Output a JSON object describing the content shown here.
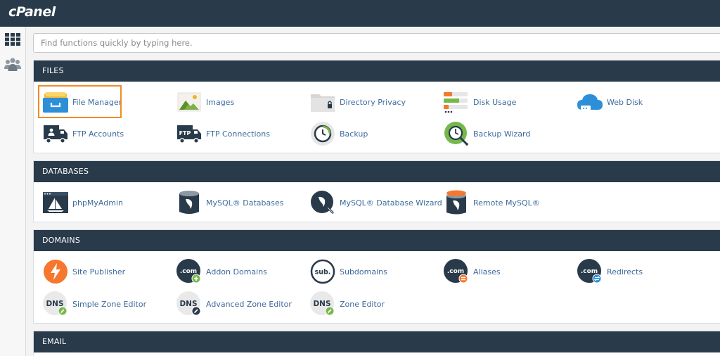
{
  "header": {
    "logo": "cPanel"
  },
  "search": {
    "placeholder": "Find functions quickly by typing here."
  },
  "sections": {
    "files": {
      "title": "FILES",
      "items": [
        {
          "label": "File Manager",
          "icon": "file-manager-icon"
        },
        {
          "label": "Images",
          "icon": "images-icon"
        },
        {
          "label": "Directory Privacy",
          "icon": "directory-privacy-icon"
        },
        {
          "label": "Disk Usage",
          "icon": "disk-usage-icon"
        },
        {
          "label": "Web Disk",
          "icon": "web-disk-icon"
        },
        {
          "label": "FTP Accounts",
          "icon": "ftp-accounts-icon"
        },
        {
          "label": "FTP Connections",
          "icon": "ftp-connections-icon"
        },
        {
          "label": "Backup",
          "icon": "backup-icon"
        },
        {
          "label": "Backup Wizard",
          "icon": "backup-wizard-icon"
        }
      ]
    },
    "databases": {
      "title": "DATABASES",
      "items": [
        {
          "label": "phpMyAdmin",
          "icon": "phpmyadmin-icon"
        },
        {
          "label": "MySQL® Databases",
          "icon": "mysql-databases-icon"
        },
        {
          "label": "MySQL® Database Wizard",
          "icon": "mysql-wizard-icon"
        },
        {
          "label": "Remote MySQL®",
          "icon": "remote-mysql-icon"
        }
      ]
    },
    "domains": {
      "title": "DOMAINS",
      "items": [
        {
          "label": "Site Publisher",
          "icon": "site-publisher-icon"
        },
        {
          "label": "Addon Domains",
          "icon": "addon-domains-icon",
          "text": ".com"
        },
        {
          "label": "Subdomains",
          "icon": "subdomains-icon",
          "text": "sub."
        },
        {
          "label": "Aliases",
          "icon": "aliases-icon",
          "text": ".com"
        },
        {
          "label": "Redirects",
          "icon": "redirects-icon",
          "text": ".com"
        },
        {
          "label": "Simple Zone Editor",
          "icon": "simple-zone-editor-icon",
          "text": "DNS"
        },
        {
          "label": "Advanced Zone Editor",
          "icon": "advanced-zone-editor-icon",
          "text": "DNS"
        },
        {
          "label": "Zone Editor",
          "icon": "zone-editor-icon",
          "text": "DNS"
        }
      ]
    },
    "email": {
      "title": "EMAIL"
    }
  },
  "ftp_badge": "FTP",
  "colors": {
    "topbar": "#293a4a",
    "link": "#3d6a9c",
    "highlight": "#f08a29",
    "green": "#77b84c",
    "orange": "#f6772d"
  }
}
